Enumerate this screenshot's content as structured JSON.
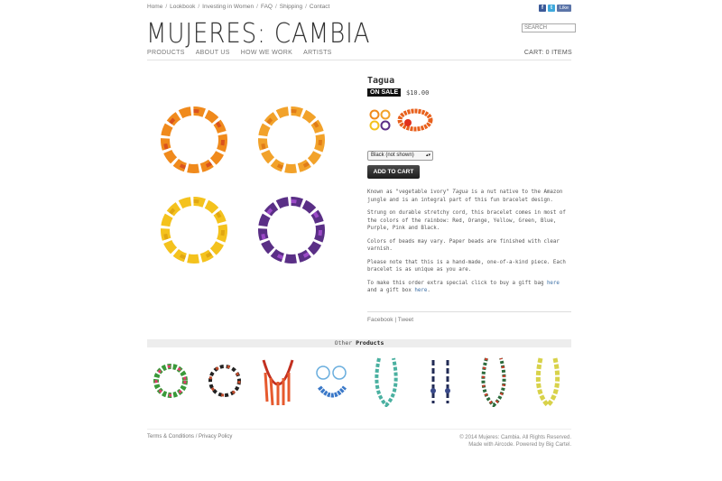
{
  "topnav": {
    "items": [
      "Home",
      "Lookbook",
      "Investing in Women",
      "FAQ",
      "Shipping",
      "Contact"
    ],
    "separator": "/"
  },
  "social": {
    "like_label": "Like"
  },
  "logo": "MUJERES: CAMBIA",
  "search": {
    "placeholder": "SEARCH"
  },
  "mainnav": {
    "items": [
      "PRODUCTS",
      "ABOUT US",
      "HOW WE WORK",
      "ARTISTS"
    ]
  },
  "cart": "CART: 0 ITEMS",
  "product": {
    "title": "Tagua",
    "sale_badge": "ON SALE",
    "price": "$10.00",
    "option_selected": "Black (not shown)",
    "add_to_cart": "ADD TO CART",
    "desc": {
      "p1_before": "Known as \"vegetable ivory\" ",
      "p1_em": "Tagua",
      "p1_after": " is a nut native to the Amazon jungle and is an integral part of this fun bracelet design.",
      "p2": "Strung on durable stretchy cord, this bracelet comes in most of the colors of the rainbow: Red, Orange, Yellow, Green, Blue, Purple, Pink and Black.",
      "p3": "Colors of beads may vary. Paper beads are finished with clear varnish.",
      "p4": "Please note that this is a hand-made, one-of-a-kind piece. Each bracelet is as unique as you are.",
      "p5_a": "To make this order extra special click to buy a gift bag ",
      "p5_link1": "here",
      "p5_b": " and a gift box ",
      "p5_link2": "here",
      "p5_c": "."
    }
  },
  "share": {
    "facebook": "Facebook",
    "sep": "|",
    "tweet": "Tweet"
  },
  "other_products": {
    "label_a": "Other ",
    "label_b": "Products"
  },
  "footer": {
    "terms": "Terms & Conditions",
    "sep": "/",
    "privacy": "Privacy Policy",
    "copyright": "© 2014 Mujeres: Cambia. All Rights Reserved.",
    "credit": "Made with Aircode. Powered by Big Cartel."
  },
  "colors": {
    "accent_link": "#3a6ea5",
    "sale_bg": "#111111"
  }
}
